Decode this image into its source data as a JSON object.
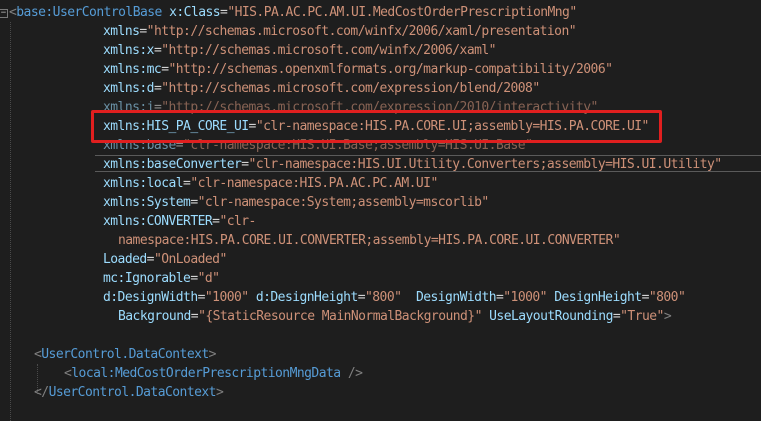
{
  "editor": {
    "lines": [
      {
        "tokens": [
          {
            "c": "t-bracket",
            "t": "<"
          },
          {
            "c": "t-tag",
            "t": "base:UserControlBase"
          },
          {
            "c": "t-eq",
            "t": " "
          },
          {
            "c": "t-attr",
            "t": "x:Class"
          },
          {
            "c": "t-eq",
            "t": "="
          },
          {
            "c": "t-str",
            "t": "\"HIS.PA.AC.PC.AM.UI.MedCostOrderPrescriptionMng\""
          }
        ]
      },
      {
        "tokens": [
          {
            "c": "t-attr",
            "t": "xmlns"
          },
          {
            "c": "t-eq",
            "t": "="
          },
          {
            "c": "t-str",
            "t": "\"http://schemas.microsoft.com/winfx/2006/xaml/presentation\""
          }
        ]
      },
      {
        "tokens": [
          {
            "c": "t-attr",
            "t": "xmlns:x"
          },
          {
            "c": "t-eq",
            "t": "="
          },
          {
            "c": "t-str",
            "t": "\"http://schemas.microsoft.com/winfx/2006/xaml\""
          }
        ]
      },
      {
        "tokens": [
          {
            "c": "t-attr",
            "t": "xmlns:mc"
          },
          {
            "c": "t-eq",
            "t": "="
          },
          {
            "c": "t-str",
            "t": "\"http://schemas.openxmlformats.org/markup-compatibility/2006\""
          }
        ]
      },
      {
        "tokens": [
          {
            "c": "t-attr",
            "t": "xmlns:d"
          },
          {
            "c": "t-eq",
            "t": "="
          },
          {
            "c": "t-str",
            "t": "\"http://schemas.microsoft.com/expression/blend/2008\""
          }
        ]
      },
      {
        "tokens": [
          {
            "c": "t-attr",
            "t": "xmlns:i"
          },
          {
            "c": "t-eq",
            "t": "="
          },
          {
            "c": "t-str",
            "t": "\"http://schemas.microsoft.com/expression/2010/interactivity\""
          }
        ]
      },
      {
        "tokens": [
          {
            "c": "t-attr",
            "t": "xmlns:HIS_PA_CORE_UI"
          },
          {
            "c": "t-eq",
            "t": "="
          },
          {
            "c": "t-str",
            "t": "\"clr-namespace:HIS.PA.CORE.UI;assembly=HIS.PA.CORE.UI\""
          }
        ]
      },
      {
        "tokens": [
          {
            "c": "t-attr",
            "t": "xmlns:base"
          },
          {
            "c": "t-eq",
            "t": "="
          },
          {
            "c": "t-str",
            "t": "\"clr-namespace:HIS.UI.Base;assembly=HIS.UI.Base\""
          }
        ]
      },
      {
        "tokens": [
          {
            "c": "t-attr",
            "t": "xmlns:baseConverter"
          },
          {
            "c": "t-eq",
            "t": "="
          },
          {
            "c": "t-str",
            "t": "\"clr-namespace:HIS.UI.Utility.Converters;assembly=HIS.UI.Utility\""
          }
        ]
      },
      {
        "tokens": [
          {
            "c": "t-attr",
            "t": "xmlns:local"
          },
          {
            "c": "t-eq",
            "t": "="
          },
          {
            "c": "t-str",
            "t": "\"clr-namespace:HIS.PA.AC.PC.AM.UI\""
          }
        ]
      },
      {
        "tokens": [
          {
            "c": "t-attr",
            "t": "xmlns:System"
          },
          {
            "c": "t-eq",
            "t": "="
          },
          {
            "c": "t-str",
            "t": "\"clr-namespace:System;assembly=mscorlib\""
          }
        ]
      },
      {
        "tokens": [
          {
            "c": "t-attr",
            "t": "xmlns:CONVERTER"
          },
          {
            "c": "t-eq",
            "t": "="
          },
          {
            "c": "t-str",
            "t": "\"clr-"
          }
        ]
      },
      {
        "tokens": [
          {
            "c": "t-str",
            "t": "namespace:HIS.PA.CORE.UI.CONVERTER;assembly=HIS.PA.CORE.UI.CONVERTER\""
          }
        ]
      },
      {
        "tokens": [
          {
            "c": "t-attr",
            "t": "Loaded"
          },
          {
            "c": "t-eq",
            "t": "="
          },
          {
            "c": "t-str",
            "t": "\"OnLoaded\""
          }
        ]
      },
      {
        "tokens": [
          {
            "c": "t-attr",
            "t": "mc:Ignorable"
          },
          {
            "c": "t-eq",
            "t": "="
          },
          {
            "c": "t-str",
            "t": "\"d\""
          }
        ]
      },
      {
        "tokens": [
          {
            "c": "t-attr",
            "t": "d:DesignWidth"
          },
          {
            "c": "t-eq",
            "t": "="
          },
          {
            "c": "t-str",
            "t": "\"1000\""
          },
          {
            "c": "t-eq",
            "t": " "
          },
          {
            "c": "t-attr",
            "t": "d:DesignHeight"
          },
          {
            "c": "t-eq",
            "t": "="
          },
          {
            "c": "t-str",
            "t": "\"800\""
          },
          {
            "c": "t-eq",
            "t": "  "
          },
          {
            "c": "t-attr",
            "t": "DesignWidth"
          },
          {
            "c": "t-eq",
            "t": "="
          },
          {
            "c": "t-str",
            "t": "\"1000\""
          },
          {
            "c": "t-eq",
            "t": " "
          },
          {
            "c": "t-attr",
            "t": "DesignHeight"
          },
          {
            "c": "t-eq",
            "t": "="
          },
          {
            "c": "t-str",
            "t": "\"800\""
          }
        ]
      },
      {
        "tokens": [
          {
            "c": "t-attr",
            "t": "Background"
          },
          {
            "c": "t-eq",
            "t": "="
          },
          {
            "c": "t-str",
            "t": "\"{StaticResource MainNormalBackground}\""
          },
          {
            "c": "t-eq",
            "t": " "
          },
          {
            "c": "t-attr",
            "t": "UseLayoutRounding"
          },
          {
            "c": "t-eq",
            "t": "="
          },
          {
            "c": "t-str",
            "t": "\"True\""
          },
          {
            "c": "t-bracket",
            "t": ">"
          }
        ]
      },
      {
        "tokens": []
      },
      {
        "tokens": [
          {
            "c": "t-bracket",
            "t": "<"
          },
          {
            "c": "t-tag",
            "t": "UserControl.DataContext"
          },
          {
            "c": "t-bracket",
            "t": ">"
          }
        ]
      },
      {
        "tokens": [
          {
            "c": "t-bracket",
            "t": "<"
          },
          {
            "c": "t-tag",
            "t": "local:MedCostOrderPrescriptionMngData"
          },
          {
            "c": "t-eq",
            "t": " "
          },
          {
            "c": "t-bracket",
            "t": "/>"
          }
        ]
      },
      {
        "tokens": [
          {
            "c": "t-bracket",
            "t": "</"
          },
          {
            "c": "t-tag",
            "t": "UserControl.DataContext"
          },
          {
            "c": "t-bracket",
            "t": ">"
          }
        ]
      }
    ]
  },
  "highlight": {
    "box_color": "#e01f1f",
    "highlighted_line_index": 6,
    "caret_line_index": 8
  },
  "collapse_toggle": {
    "symbol": "−"
  }
}
